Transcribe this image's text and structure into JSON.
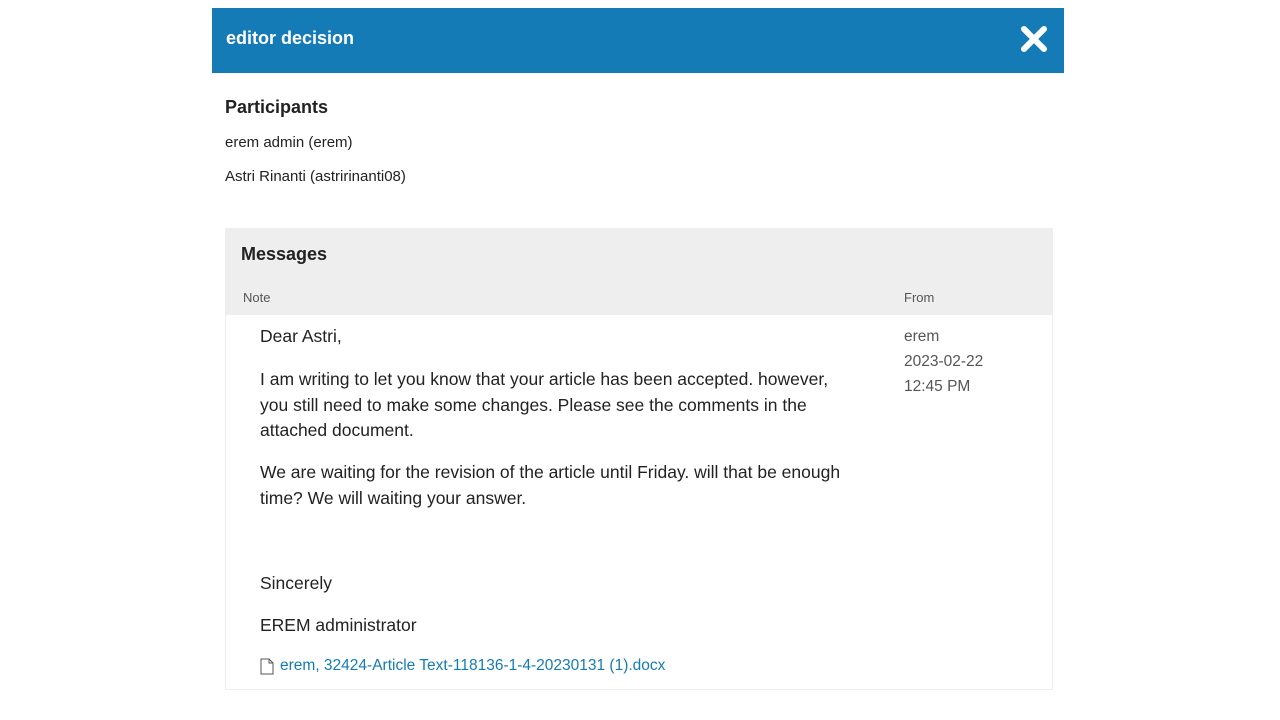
{
  "modal": {
    "title": "editor decision",
    "close_icon": "close-icon",
    "header_color": "#157bb6"
  },
  "participants": {
    "heading": "Participants",
    "items": [
      "erem admin (erem)",
      "Astri Rinanti (astririnanti08)"
    ]
  },
  "messages": {
    "heading": "Messages",
    "columns": {
      "note": "Note",
      "from": "From"
    },
    "entry": {
      "greeting": "Dear Astri,",
      "paragraph_1_lines": [
        "I am writing to let you know that your article has been accepted. however,",
        "you still need to make some changes. Please see the comments in the",
        "attached document."
      ],
      "paragraph_2_lines": [
        "We are waiting for the revision of the article until Friday. will that be enough",
        "time? We will waiting your answer."
      ],
      "closing": "Sincerely",
      "signature": "EREM administrator",
      "from_user": "erem",
      "from_date": "2023-02-22",
      "from_time": "12:45 PM",
      "attachment": {
        "icon": "file-icon",
        "label": "erem, 32424-Article Text-118136-1-4-20230131 (1).docx"
      }
    }
  }
}
